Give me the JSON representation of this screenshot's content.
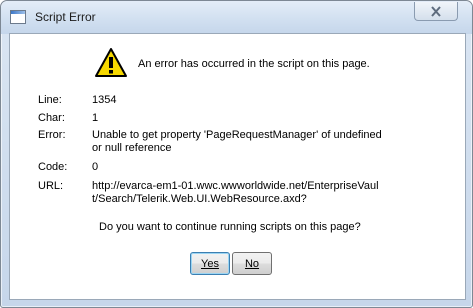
{
  "window": {
    "title": "Script Error"
  },
  "dialog": {
    "message": "An error has occurred in the script on this page.",
    "fields": {
      "line_label": "Line:",
      "line_value": "1354",
      "char_label": "Char:",
      "char_value": "1",
      "error_label": "Error:",
      "error_value": "Unable to get property 'PageRequestManager' of undefined or null reference",
      "code_label": "Code:",
      "code_value": "0",
      "url_label": "URL:",
      "url_value": "http://evarca-em1-01.wwc.wwworldwide.net/EnterpriseVault/Search/Telerik.Web.UI.WebResource.axd?"
    },
    "question": "Do you want to continue running scripts on this page?",
    "buttons": {
      "yes_label": "Yes",
      "no_label": "No"
    }
  },
  "icons": {
    "app": "window-icon",
    "warning": "warning-icon",
    "close": "close-icon"
  },
  "colors": {
    "warning_fill": "#f6d800",
    "title_bar": "#d3e1f1",
    "default_button_border": "#3c7fb1"
  }
}
